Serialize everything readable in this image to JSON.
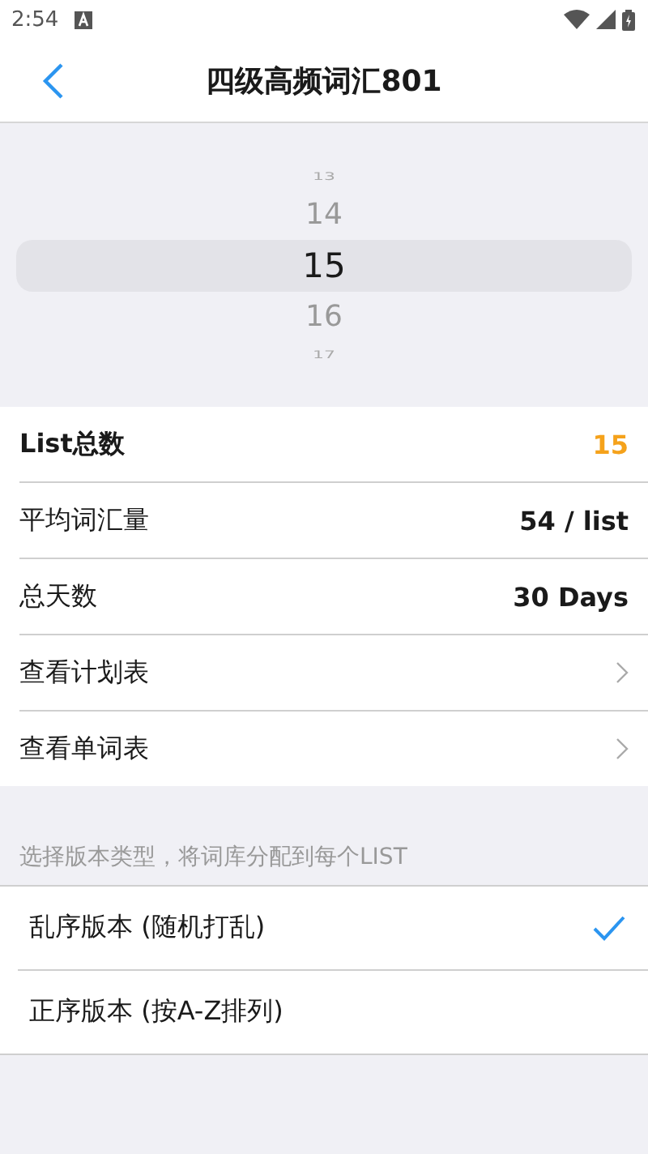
{
  "status_bar": {
    "time": "2:54"
  },
  "header": {
    "title": "四级高频词汇801"
  },
  "picker": {
    "items": [
      {
        "label": "13",
        "selected": false
      },
      {
        "label": "14",
        "selected": false
      },
      {
        "label": "15",
        "selected": true
      },
      {
        "label": "16",
        "selected": false
      },
      {
        "label": "17",
        "selected": false
      }
    ]
  },
  "settings": [
    {
      "kind": "value",
      "label": "List总数",
      "value": "15",
      "accent": true
    },
    {
      "kind": "value",
      "label": "平均词汇量",
      "value": "54 / list",
      "accent": false
    },
    {
      "kind": "value",
      "label": "总天数",
      "value": "30 Days",
      "accent": false
    },
    {
      "kind": "link",
      "label": "查看计划表"
    },
    {
      "kind": "link",
      "label": "查看单词表"
    }
  ],
  "version_section": {
    "caption": "选择版本类型，将词库分配到每个LIST",
    "options": [
      {
        "label": "乱序版本 (随机打乱)",
        "selected": true
      },
      {
        "label": "正序版本 (按A-Z排列)",
        "selected": false
      }
    ]
  }
}
